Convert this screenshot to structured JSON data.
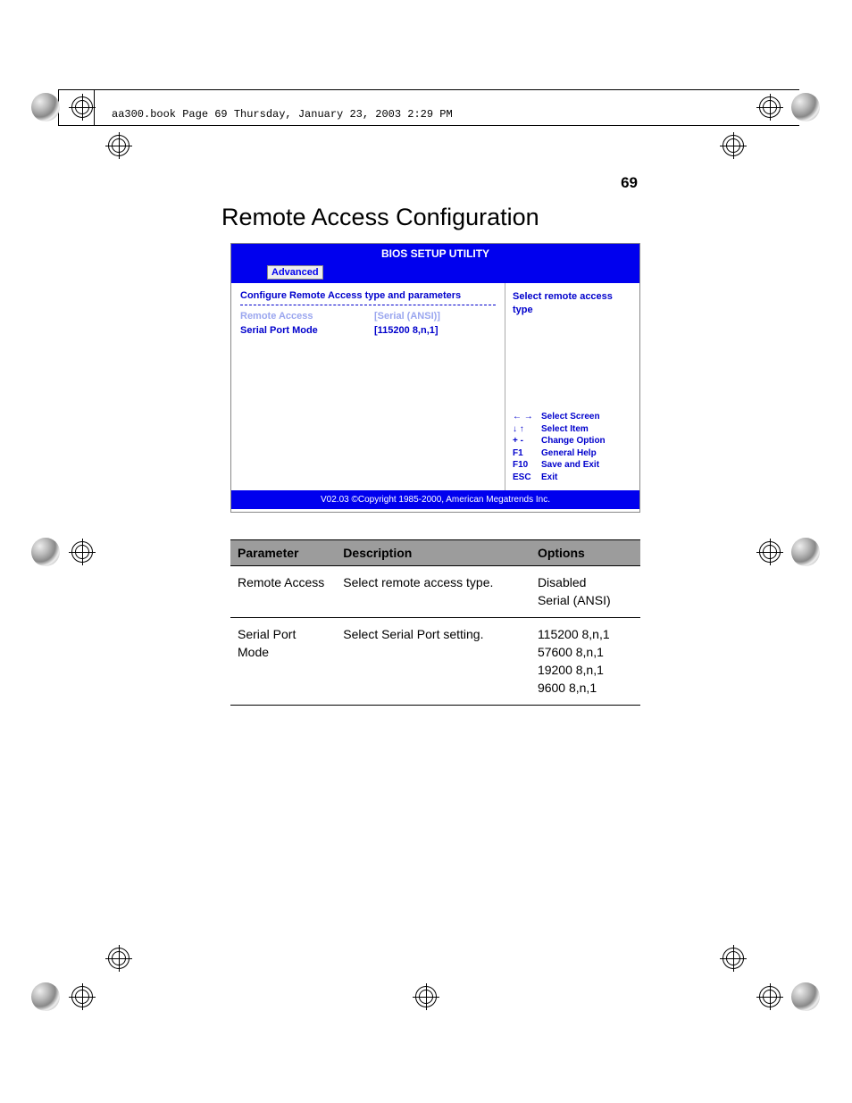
{
  "header_line": "aa300.book  Page 69  Thursday, January 23, 2003  2:29 PM",
  "page_number": "69",
  "section_title": "Remote Access Configuration",
  "bios": {
    "title": "BIOS SETUP UTILITY",
    "active_tab": "Advanced",
    "instruction": "Configure Remote Access type and parameters",
    "rows": [
      {
        "label": "Remote Access",
        "value": "[Serial (ANSI)]",
        "selected": true
      },
      {
        "label": "Serial Port Mode",
        "value": "[115200 8,n,1]",
        "selected": false
      }
    ],
    "help_text": "Select remote access type",
    "keys": [
      {
        "sym": "← →",
        "desc": "Select Screen"
      },
      {
        "sym": "↓ ↑",
        "desc": "Select Item"
      },
      {
        "sym": "+ -",
        "desc": "Change Option"
      },
      {
        "sym": "F1",
        "desc": "General Help"
      },
      {
        "sym": "F10",
        "desc": "Save and Exit"
      },
      {
        "sym": "ESC",
        "desc": "Exit"
      }
    ],
    "footer": "V02.03 ©Copyright 1985-2000, American Megatrends Inc."
  },
  "table": {
    "headers": {
      "param": "Parameter",
      "desc": "Description",
      "opts": "Options"
    },
    "rows": [
      {
        "param": "Remote Access",
        "desc": "Select remote access type.",
        "opts": "Disabled\nSerial (ANSI)"
      },
      {
        "param": "Serial Port Mode",
        "desc": "Select Serial Port setting.",
        "opts": "115200 8,n,1\n57600 8,n,1\n19200 8,n,1\n9600 8,n,1"
      }
    ]
  }
}
